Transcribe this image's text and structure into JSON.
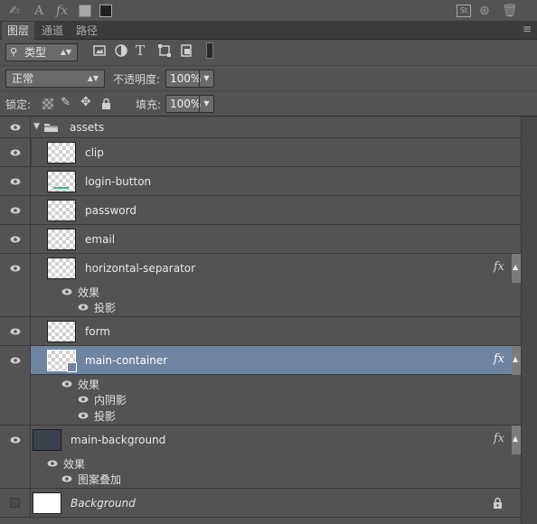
{
  "tabs": [
    {
      "label": "图层",
      "active": true
    },
    {
      "label": "通道",
      "active": false
    },
    {
      "label": "路径",
      "active": false
    }
  ],
  "filter": {
    "kind_label": "类型"
  },
  "blend": {
    "mode": "正常",
    "opacity_label": "不透明度:",
    "opacity_value": "100%"
  },
  "lock": {
    "label": "锁定:",
    "fill_label": "填充:",
    "fill_value": "100%"
  },
  "effects_label": "效果",
  "layers": {
    "assets": "assets",
    "clip": "clip",
    "login_button": "login-button",
    "password": "password",
    "email": "email",
    "horizontal_separator": "horizontal-separator",
    "horizontal_separator_fx": [
      "投影"
    ],
    "form": "form",
    "main_container": "main-container",
    "main_container_fx": [
      "内阴影",
      "投影"
    ],
    "main_background": "main-background",
    "main_background_fx": [
      "图案叠加"
    ],
    "background": "Background"
  },
  "fx_badge": "fx",
  "colors": {
    "panel": "#535353",
    "selected": "#6f84a0",
    "dark": "#3c3c3c"
  },
  "icons": [
    "eye-icon",
    "folder-icon",
    "lock-icon",
    "search-icon",
    "fx-icon",
    "menu-icon",
    "trash-icon"
  ]
}
